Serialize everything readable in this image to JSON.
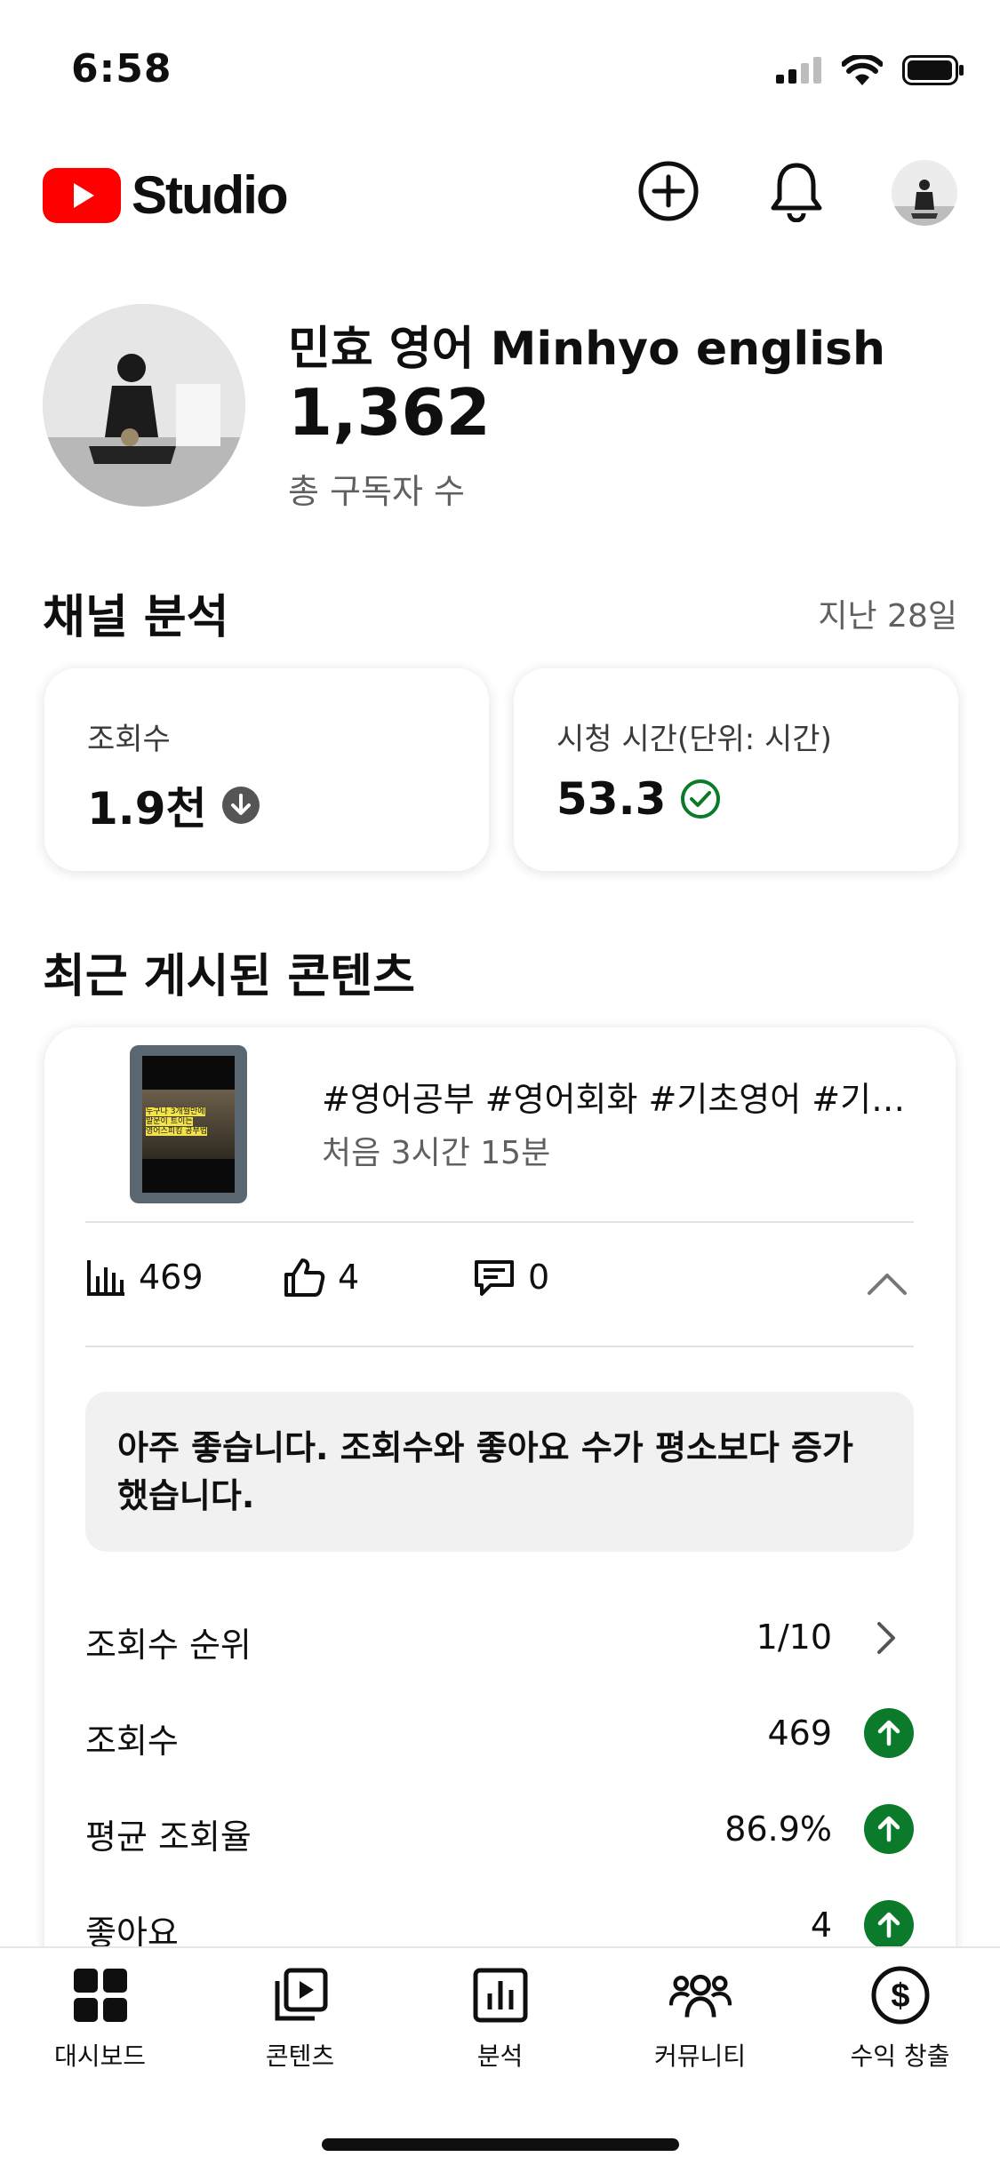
{
  "status_bar": {
    "time": "6:58"
  },
  "header": {
    "logo_text": "Studio",
    "brand_color": "#ff0000"
  },
  "channel": {
    "name": "민효 영어 Minhyo english",
    "subscribers": "1,362",
    "subscribers_label": "총 구독자 수"
  },
  "analytics": {
    "title": "채널 분석",
    "period": "지난 28일",
    "cards": [
      {
        "label": "조회수",
        "value": "1.9천",
        "trend": "down"
      },
      {
        "label": "시청 시간(단위: 시간)",
        "value": "53.3",
        "trend": "check"
      }
    ]
  },
  "recent": {
    "title": "최근 게시된 콘텐츠",
    "video": {
      "title": "#영어공부 #영어회화 #기초영어 #기초영어회화",
      "subtitle": "처음 3시간 15분",
      "thumb_caption_1": "누구나 3개월만에",
      "thumb_caption_2": "말문이 트이는",
      "thumb_caption_3": "영어스피킹 공부법"
    },
    "stats": {
      "views": "469",
      "likes": "4",
      "comments": "0"
    },
    "insight": "아주 좋습니다. 조회수와 좋아요 수가 평소보다 증가했습니다.",
    "rows": [
      {
        "label": "조회수 순위",
        "value": "1/10",
        "indicator": "chevron-right"
      },
      {
        "label": "조회수",
        "value": "469",
        "indicator": "arrow-up"
      },
      {
        "label": "평균 조회율",
        "value": "86.9%",
        "indicator": "arrow-up"
      },
      {
        "label": "좋아요",
        "value": "4",
        "indicator": "arrow-up"
      }
    ],
    "positive_color": "#0b7a2a"
  },
  "bottom_nav": [
    {
      "label": "대시보드",
      "icon": "dashboard-icon"
    },
    {
      "label": "콘텐츠",
      "icon": "content-icon"
    },
    {
      "label": "분석",
      "icon": "analytics-icon"
    },
    {
      "label": "커뮤니티",
      "icon": "community-icon"
    },
    {
      "label": "수익 창출",
      "icon": "monetization-icon"
    }
  ]
}
